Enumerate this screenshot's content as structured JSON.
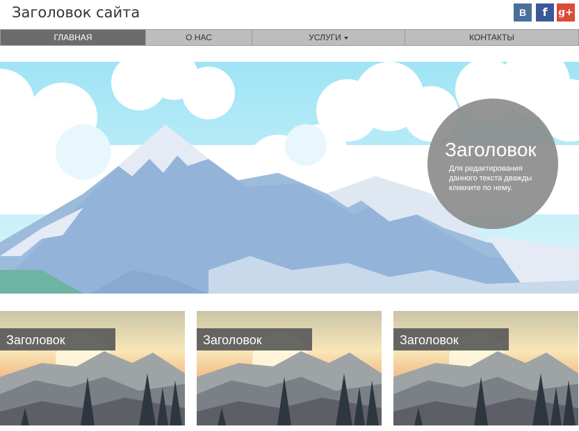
{
  "header": {
    "site_title": "Заголовок сайта",
    "social": [
      {
        "name": "vk-icon",
        "glyph": "В",
        "color": "#4a6f9a"
      },
      {
        "name": "facebook-icon",
        "glyph": "f",
        "color": "#3b5998"
      },
      {
        "name": "google-plus-icon",
        "glyph": "g+",
        "color": "#dc4a38"
      }
    ]
  },
  "nav": {
    "items": [
      {
        "label": "ГЛАВНАЯ",
        "active": true
      },
      {
        "label": "О НАС",
        "active": false
      },
      {
        "label": "УСЛУГИ",
        "active": false,
        "dropdown": true
      },
      {
        "label": "КОНТАКТЫ",
        "active": false
      }
    ]
  },
  "hero": {
    "heading": "Заголовок",
    "text": "Для редактирования данного текста дважды кликните по нему."
  },
  "cards": [
    {
      "label": "Заголовок"
    },
    {
      "label": "Заголовок"
    },
    {
      "label": "Заголовок"
    }
  ],
  "colors": {
    "nav_active": "#6b6b6b",
    "nav_bg": "#bdbdbd",
    "sky": "#9fe4f5"
  }
}
